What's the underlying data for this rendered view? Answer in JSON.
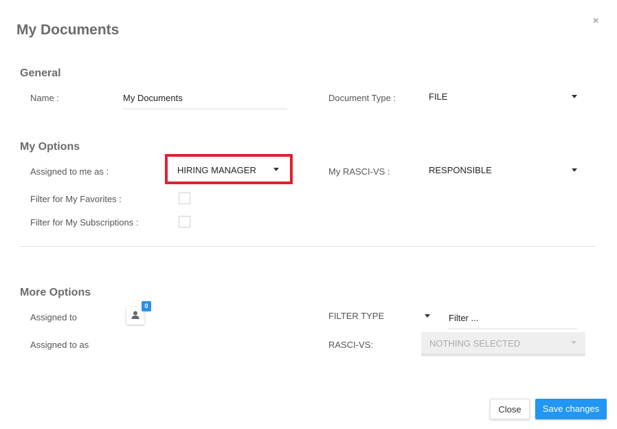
{
  "dialog": {
    "title": "My Documents",
    "close_glyph": "×"
  },
  "general": {
    "heading": "General",
    "name_label": "Name :",
    "name_value": "My Documents",
    "doctype_label": "Document Type :",
    "doctype_value": "FILE"
  },
  "my_options": {
    "heading": "My Options",
    "assigned_label": "Assigned to me as :",
    "assigned_value": "HIRING MANAGER",
    "rasci_label": "My RASCI-VS :",
    "rasci_value": "RESPONSIBLE",
    "favorites_label": "Filter for My Favorites :",
    "favorites_checked": false,
    "subscriptions_label": "Filter for My Subscriptions :",
    "subscriptions_checked": false
  },
  "more_options": {
    "heading": "More Options",
    "assigned_to_label": "Assigned to",
    "assigned_count": "0",
    "assigned_as_label": "Assigned to as",
    "filter_type_label": "FILTER TYPE",
    "filter_value": "Filter ...",
    "rasci_label": "RASCI-VS:",
    "rasci_value": "NOTHING SELECTED"
  },
  "footer": {
    "close_label": "Close",
    "save_label": "Save changes"
  },
  "colors": {
    "highlight": "#e02131",
    "primary": "#2196f3",
    "badge": "#2c8fe6"
  },
  "icons": {
    "close": "close-icon",
    "caret": "caret-down-icon",
    "user": "user-icon"
  }
}
